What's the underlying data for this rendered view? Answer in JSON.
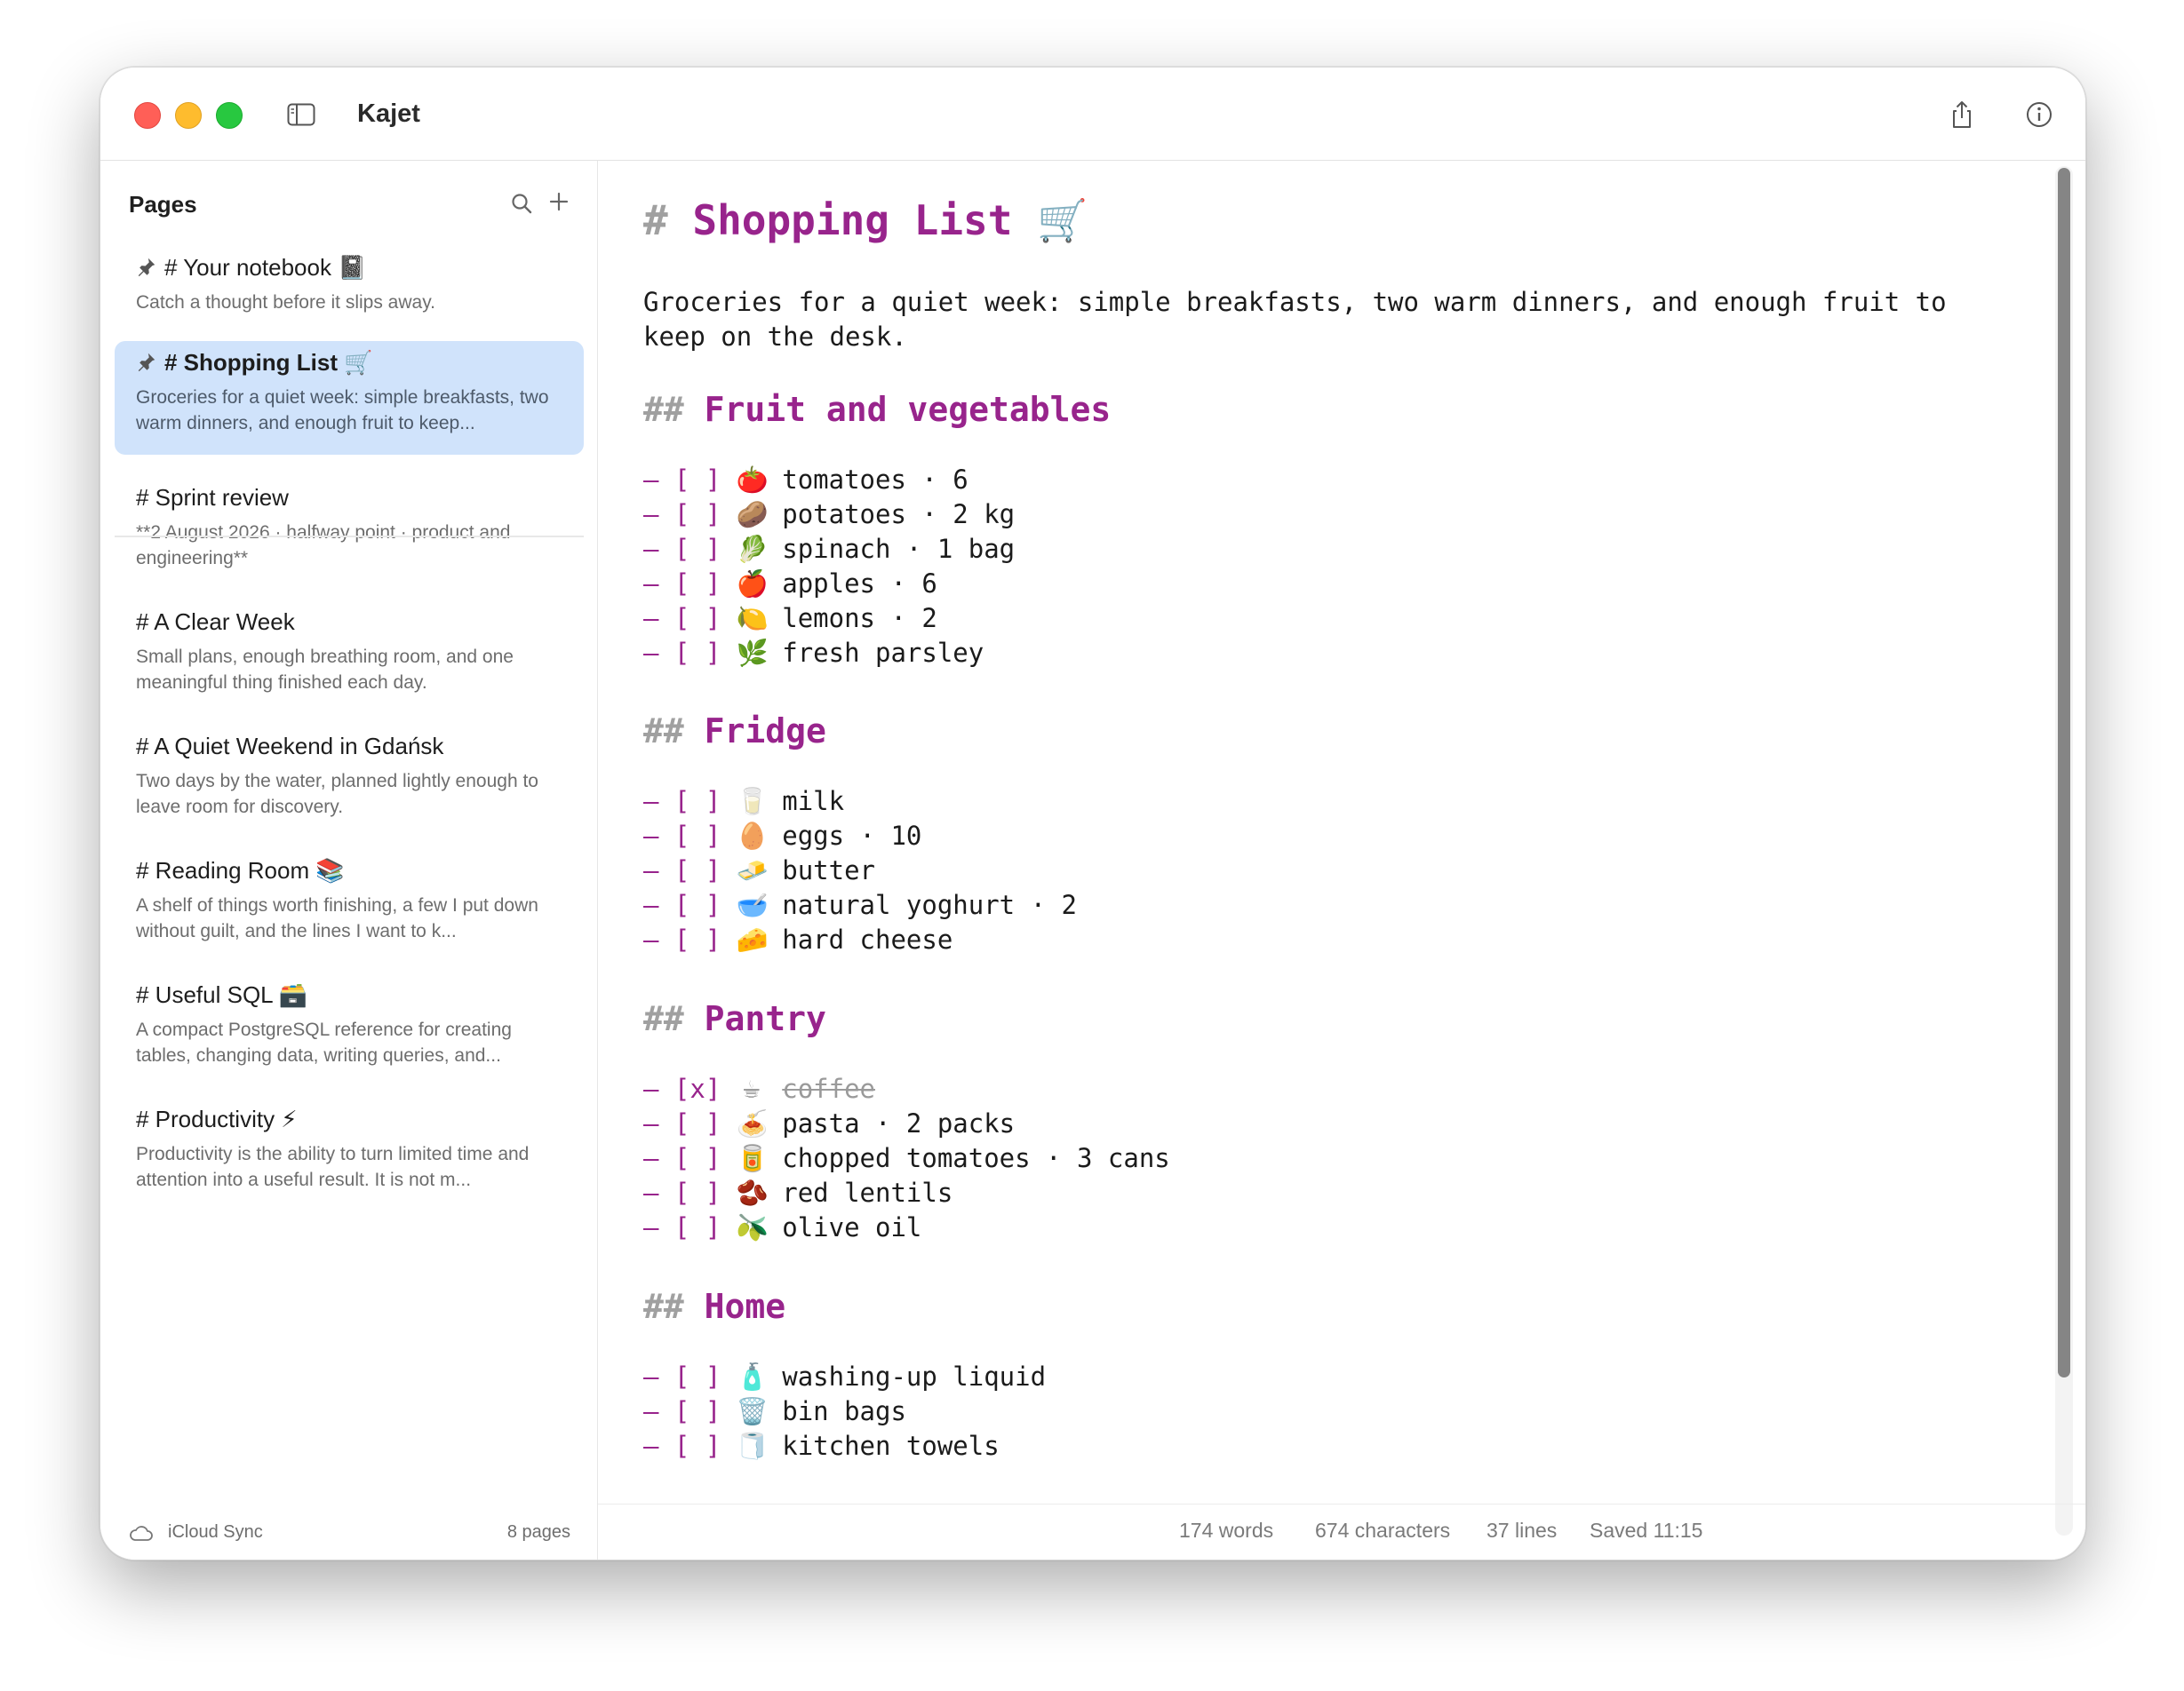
{
  "app": {
    "title": "Kajet"
  },
  "sidebar": {
    "title": "Pages",
    "notes": [
      {
        "title": "# Your notebook 📓",
        "subtitle": "Catch a thought before it slips away.",
        "pinned": true,
        "selected": false
      },
      {
        "title": "# Shopping List 🛒",
        "subtitle": "Groceries for a quiet week: simple breakfasts, two warm dinners, and enough fruit to keep...",
        "pinned": true,
        "selected": true
      },
      {
        "title": "# Sprint review",
        "subtitle": "**2 August 2026 · halfway point · product and engineering**",
        "pinned": false,
        "selected": false
      },
      {
        "title": "# A Clear Week",
        "subtitle": "Small plans, enough breathing room, and one meaningful thing finished each day.",
        "pinned": false,
        "selected": false
      },
      {
        "title": "# A Quiet Weekend in Gdańsk",
        "subtitle": "Two days by the water, planned lightly enough to leave room for discovery.",
        "pinned": false,
        "selected": false
      },
      {
        "title": "# Reading Room 📚",
        "subtitle": "A shelf of things worth finishing, a few I put down without guilt, and the lines I want to k...",
        "pinned": false,
        "selected": false
      },
      {
        "title": "# Useful SQL 🗃️",
        "subtitle": "A compact PostgreSQL reference for creating tables, changing data, writing queries, and...",
        "pinned": false,
        "selected": false
      },
      {
        "title": "# Productivity ⚡",
        "subtitle": "Productivity is the ability to turn limited time and attention into a useful result. It is not m...",
        "pinned": false,
        "selected": false
      }
    ],
    "footer": {
      "sync": "iCloud Sync",
      "count": "8 pages"
    }
  },
  "editor": {
    "title_hash": "#",
    "title": "Shopping List 🛒",
    "intro": "Groceries for a quiet week: simple breakfasts, two warm dinners, and enough fruit to keep on the desk.",
    "sections": [
      {
        "hash": "##",
        "heading": "Fruit and vegetables",
        "items": [
          {
            "box": "[ ]",
            "emoji": "🍅",
            "text": "tomatoes · 6",
            "done": false
          },
          {
            "box": "[ ]",
            "emoji": "🥔",
            "text": "potatoes · 2 kg",
            "done": false
          },
          {
            "box": "[ ]",
            "emoji": "🥬",
            "text": "spinach · 1 bag",
            "done": false
          },
          {
            "box": "[ ]",
            "emoji": "🍎",
            "text": "apples · 6",
            "done": false
          },
          {
            "box": "[ ]",
            "emoji": "🍋",
            "text": "lemons · 2",
            "done": false
          },
          {
            "box": "[ ]",
            "emoji": "🌿",
            "text": "fresh parsley",
            "done": false
          }
        ]
      },
      {
        "hash": "##",
        "heading": "Fridge",
        "items": [
          {
            "box": "[ ]",
            "emoji": "🥛",
            "text": "milk",
            "done": false
          },
          {
            "box": "[ ]",
            "emoji": "🥚",
            "text": "eggs · 10",
            "done": false
          },
          {
            "box": "[ ]",
            "emoji": "🧈",
            "text": "butter",
            "done": false
          },
          {
            "box": "[ ]",
            "emoji": "🥣",
            "text": "natural yoghurt · 2",
            "done": false
          },
          {
            "box": "[ ]",
            "emoji": "🧀",
            "text": "hard cheese",
            "done": false
          }
        ]
      },
      {
        "hash": "##",
        "heading": "Pantry",
        "items": [
          {
            "box": "[x]",
            "emoji": "☕",
            "text": "coffee",
            "done": true
          },
          {
            "box": "[ ]",
            "emoji": "🍝",
            "text": "pasta · 2 packs",
            "done": false
          },
          {
            "box": "[ ]",
            "emoji": "🥫",
            "text": "chopped tomatoes · 3 cans",
            "done": false
          },
          {
            "box": "[ ]",
            "emoji": "🫘",
            "text": "red lentils",
            "done": false
          },
          {
            "box": "[ ]",
            "emoji": "🫒",
            "text": "olive oil",
            "done": false
          }
        ]
      },
      {
        "hash": "##",
        "heading": "Home",
        "items": [
          {
            "box": "[ ]",
            "emoji": "🧴",
            "text": "washing-up liquid",
            "done": false
          },
          {
            "box": "[ ]",
            "emoji": "🗑️",
            "text": "bin bags",
            "done": false
          },
          {
            "box": "[ ]",
            "emoji": "🧻",
            "text": "kitchen towels",
            "done": false
          }
        ]
      }
    ]
  },
  "status": {
    "words": "174 words",
    "characters": "674 characters",
    "lines": "37 lines",
    "saved": "Saved 11:15"
  }
}
